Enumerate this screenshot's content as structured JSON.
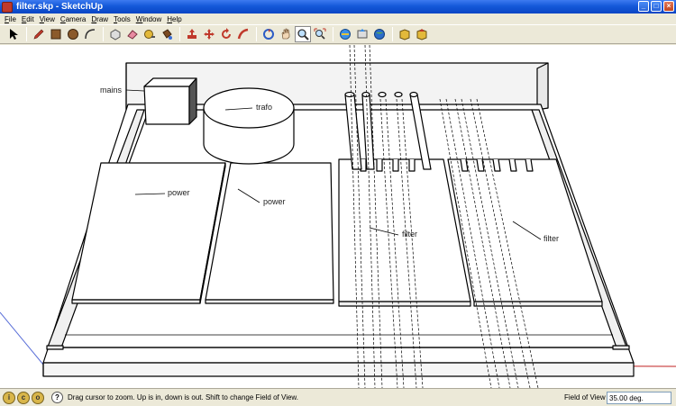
{
  "window": {
    "title": "filter.skp - SketchUp",
    "minimize": "_",
    "maximize": "□",
    "close": "×"
  },
  "menu": [
    "File",
    "Edit",
    "View",
    "Camera",
    "Draw",
    "Tools",
    "Window",
    "Help"
  ],
  "toolbar": {
    "tools": [
      {
        "name": "select-tool-icon",
        "group": 1
      },
      {
        "name": "pencil-tool-icon",
        "group": 1
      },
      {
        "name": "rectangle-tool-icon",
        "group": 1
      },
      {
        "name": "circle-tool-icon",
        "group": 1
      },
      {
        "name": "arc-tool-icon",
        "group": 1
      },
      {
        "name": "make-component-icon",
        "group": 2
      },
      {
        "name": "eraser-tool-icon",
        "group": 2
      },
      {
        "name": "tape-measure-icon",
        "group": 2
      },
      {
        "name": "paint-bucket-icon",
        "group": 2
      },
      {
        "name": "push-pull-icon",
        "group": 3
      },
      {
        "name": "move-tool-icon",
        "group": 3
      },
      {
        "name": "rotate-tool-icon",
        "group": 3
      },
      {
        "name": "follow-me-icon",
        "group": 3
      },
      {
        "name": "orbit-tool-icon",
        "group": 4
      },
      {
        "name": "pan-tool-icon",
        "group": 4
      },
      {
        "name": "zoom-tool-icon",
        "group": 4
      },
      {
        "name": "zoom-extents-icon",
        "group": 4
      },
      {
        "name": "get-models-icon",
        "group": 5
      },
      {
        "name": "share-model-icon",
        "group": 5
      },
      {
        "name": "google-earth-icon",
        "group": 5
      },
      {
        "name": "component-browser-icon",
        "group": 6
      },
      {
        "name": "share-component-icon",
        "group": 6
      }
    ]
  },
  "labels": {
    "mains": "mains",
    "trafo": "trafo",
    "power_left": "power",
    "power_right": "power",
    "filter_left": "filter",
    "filter_right": "filter"
  },
  "status": {
    "message": "Drag cursor to zoom.  Up is in, down is out. Shift to change Field of View.",
    "vcb_label": "Field of View",
    "vcb_value": "35.00 deg."
  }
}
